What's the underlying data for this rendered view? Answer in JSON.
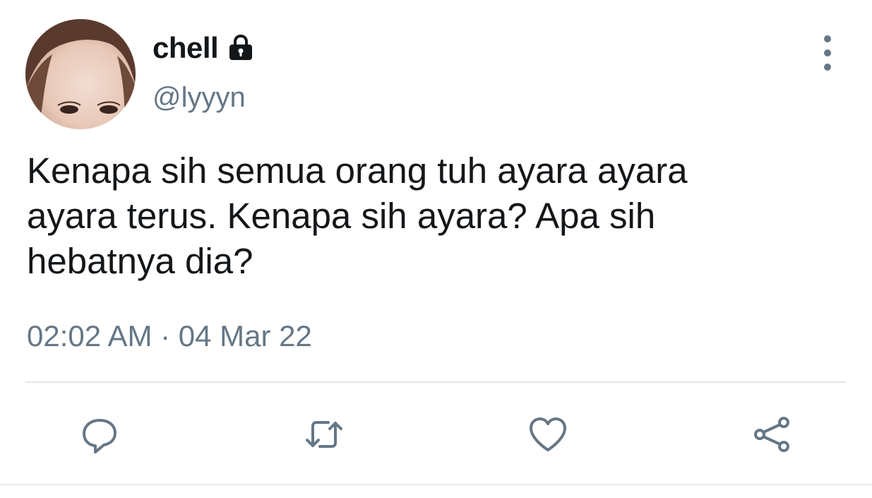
{
  "tweet": {
    "author": {
      "display_name": "chell",
      "handle": "@lyyyn",
      "protected_icon": "lock-icon",
      "avatar": "avatar-photo"
    },
    "text": "Kenapa sih semua orang tuh ayara ayara\nayara terus. Kenapa sih ayara? Apa sih\nhebatnya dia?",
    "time": "02:02 AM",
    "separator": " · ",
    "date": "04 Mar 22",
    "menu_icon": "more-vertical-icon",
    "actions": [
      {
        "name": "reply",
        "icon": "reply-icon"
      },
      {
        "name": "retweet",
        "icon": "retweet-icon"
      },
      {
        "name": "like",
        "icon": "heart-icon"
      },
      {
        "name": "share",
        "icon": "share-icon"
      }
    ]
  },
  "colors": {
    "text_primary": "#14171a",
    "text_secondary": "#657786",
    "divider": "#e1e8ed"
  }
}
